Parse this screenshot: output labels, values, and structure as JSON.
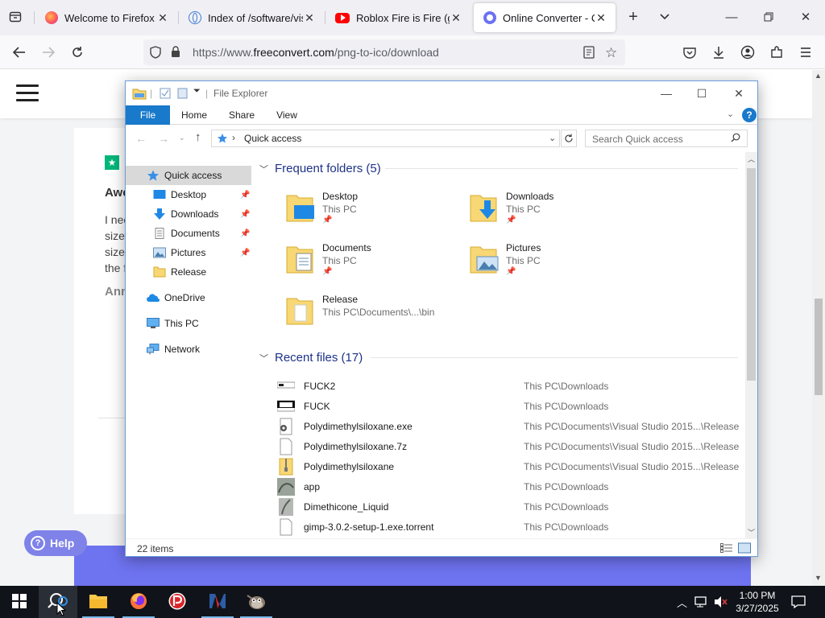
{
  "browser": {
    "tabs": [
      {
        "title": "Welcome to Firefox",
        "active": false
      },
      {
        "title": "Index of /software/visu",
        "active": false
      },
      {
        "title": "Roblox Fire is Fire (get",
        "active": false
      },
      {
        "title": "Online Converter - Cor",
        "active": true
      }
    ],
    "url_prefix": "https://www.",
    "url_domain": "freeconvert.com",
    "url_path": "/png-to-ico/download"
  },
  "webpage": {
    "stars": "★",
    "review_title": "Awe",
    "review_body": "I nee\nsize\nsize\nthe f",
    "review_author": "Ann",
    "help_label": "Help"
  },
  "explorer": {
    "title": "File Explorer",
    "ribbon_tabs": [
      "File",
      "Home",
      "Share",
      "View"
    ],
    "address": "Quick access",
    "search_placeholder": "Search Quick access",
    "nav": [
      {
        "label": "Quick access",
        "pinned": false
      },
      {
        "label": "Desktop",
        "pinned": true
      },
      {
        "label": "Downloads",
        "pinned": true
      },
      {
        "label": "Documents",
        "pinned": true
      },
      {
        "label": "Pictures",
        "pinned": true
      },
      {
        "label": "Release",
        "pinned": false
      },
      {
        "label": "OneDrive",
        "pinned": false
      },
      {
        "label": "This PC",
        "pinned": false
      },
      {
        "label": "Network",
        "pinned": false
      }
    ],
    "frequent_header": "Frequent folders (5)",
    "frequent": [
      {
        "name": "Desktop",
        "location": "This PC"
      },
      {
        "name": "Downloads",
        "location": "This PC"
      },
      {
        "name": "Documents",
        "location": "This PC"
      },
      {
        "name": "Pictures",
        "location": "This PC"
      },
      {
        "name": "Release",
        "location": "This PC\\Documents\\...\\bin"
      }
    ],
    "recent_header": "Recent files (17)",
    "recent": [
      {
        "name": "FUCK2",
        "location": "This PC\\Downloads"
      },
      {
        "name": "FUCK",
        "location": "This PC\\Downloads"
      },
      {
        "name": "Polydimethylsiloxane.exe",
        "location": "This PC\\Documents\\Visual Studio 2015...\\Release"
      },
      {
        "name": "Polydimethylsiloxane.7z",
        "location": "This PC\\Documents\\Visual Studio 2015...\\Release"
      },
      {
        "name": "Polydimethylsiloxane",
        "location": "This PC\\Documents\\Visual Studio 2015...\\Release"
      },
      {
        "name": "app",
        "location": "This PC\\Downloads"
      },
      {
        "name": "Dimethicone_Liquid",
        "location": "This PC\\Downloads"
      },
      {
        "name": "gimp-3.0.2-setup-1.exe.torrent",
        "location": "This PC\\Downloads"
      }
    ],
    "status": "22 items"
  },
  "taskbar": {
    "time": "1:00 PM",
    "date": "3/27/2025"
  },
  "colors": {
    "accent": "#1979ca",
    "group_header": "#1e3287",
    "help_purple": "#7f82e8",
    "taskbar": "#101319"
  }
}
